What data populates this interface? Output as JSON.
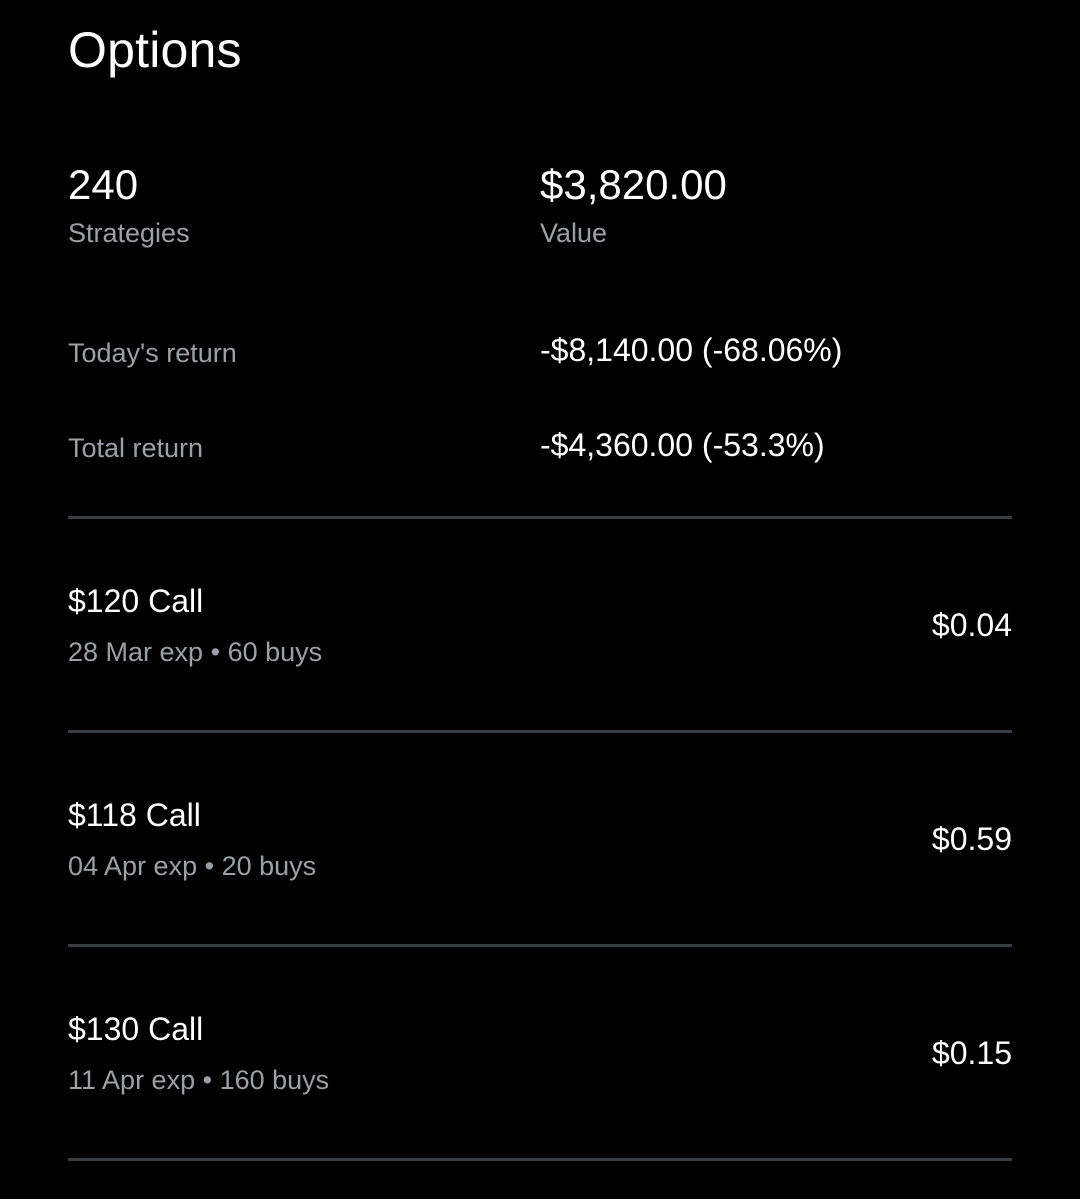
{
  "section": {
    "title": "Options"
  },
  "summary": {
    "strategies_count": "240",
    "strategies_label": "Strategies",
    "value": "$3,820.00",
    "value_label": "Value"
  },
  "returns": {
    "today_label": "Today's return",
    "today_value": "-$8,140.00 (-68.06%)",
    "total_label": "Total return",
    "total_value": "-$4,360.00 (-53.3%)"
  },
  "positions": [
    {
      "name": "$120 Call",
      "expiry": "28 Mar exp",
      "separator": "•",
      "buys": "60 buys",
      "price": "$0.04"
    },
    {
      "name": "$118 Call",
      "expiry": "04 Apr exp",
      "separator": "•",
      "buys": "20 buys",
      "price": "$0.59"
    },
    {
      "name": "$130 Call",
      "expiry": "11 Apr exp",
      "separator": "•",
      "buys": "160 buys",
      "price": "$0.15"
    }
  ],
  "colors": {
    "background": "#000000",
    "primary_text": "#ffffff",
    "secondary_text": "#9aa0a6",
    "divider": "#3a3d42"
  }
}
